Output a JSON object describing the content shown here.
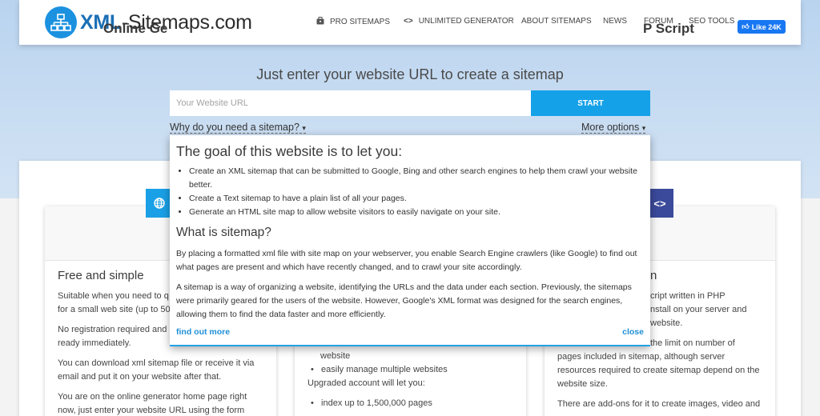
{
  "header": {
    "logo_main": "XML",
    "logo_rest": "-Sitemaps.com",
    "nav": [
      {
        "label": "PRO SITEMAPS",
        "icon": "briefcase-icon"
      },
      {
        "label": "UNLIMITED GENERATOR",
        "icon": "code-icon"
      },
      {
        "label": "ABOUT SITEMAPS",
        "icon": ""
      },
      {
        "label": "NEWS",
        "icon": ""
      },
      {
        "label": "FORUM",
        "icon": ""
      },
      {
        "label": "SEO TOOLS",
        "icon": ""
      }
    ],
    "fb_like": "Like 24K"
  },
  "hero": {
    "tagline": "Just enter your website URL to create a sitemap",
    "url_placeholder": "Your Website URL",
    "start_label": "START",
    "why_link": "Why do you need a sitemap?",
    "more_link": "More options"
  },
  "cards": {
    "online": {
      "title": "Online Ge",
      "subtitle": "Free and simple",
      "paragraphs": [
        "Suitable when you need to q",
        "for a small web site (up to 50",
        "No registration required and",
        "ready immediately.",
        "You can download xml sitemap file or receive it via",
        "email and put it on your website after that.",
        "You are on the online generator home page right",
        "now, just enter your website URL using the form"
      ]
    },
    "middle": {
      "items_top": [
        "website",
        "easily manage multiple websites"
      ],
      "upgraded_text": "Upgraded account will let you:",
      "items_bottom": [
        "index up to 1,500,000 pages"
      ]
    },
    "php": {
      "title": "P Script",
      "subtitle": "n",
      "lines": [
        "cript written in PHP",
        "nstall on your server and",
        "website.",
        "the limit on number of",
        "pages included in sitemap, although server",
        "resources required to create sitemap depend on the",
        "website size.",
        "There are add-ons for it to create images, video and"
      ]
    }
  },
  "popup": {
    "heading": "The goal of this website is to let you:",
    "bullets": [
      "Create an XML sitemap that can be submitted to Google, Bing and other search engines to help them crawl your website better.",
      "Create a Text sitemap to have a plain list of all your pages.",
      "Generate an HTML site map to allow website visitors to easily navigate on your site."
    ],
    "subheading": "What is sitemap?",
    "para1": "By placing a formatted xml file with site map on your webserver, you enable Search Engine crawlers (like Google) to find out what pages are present and which have recently changed, and to crawl your site accordingly.",
    "para2": "A sitemap is a way of organizing a website, identifying the URLs and the data under each section. Previously, the sitemaps were primarily geared for the users of the website. However, Google's XML format was designed for the search engines, allowing them to find the data faster and more efficiently.",
    "find_out_more": "find out more",
    "close": "close"
  },
  "colors": {
    "accent": "#15a1e8",
    "link": "#1f8fd6",
    "brand": "#1b6fb5",
    "php_icon_bg": "#3b4a9b"
  }
}
